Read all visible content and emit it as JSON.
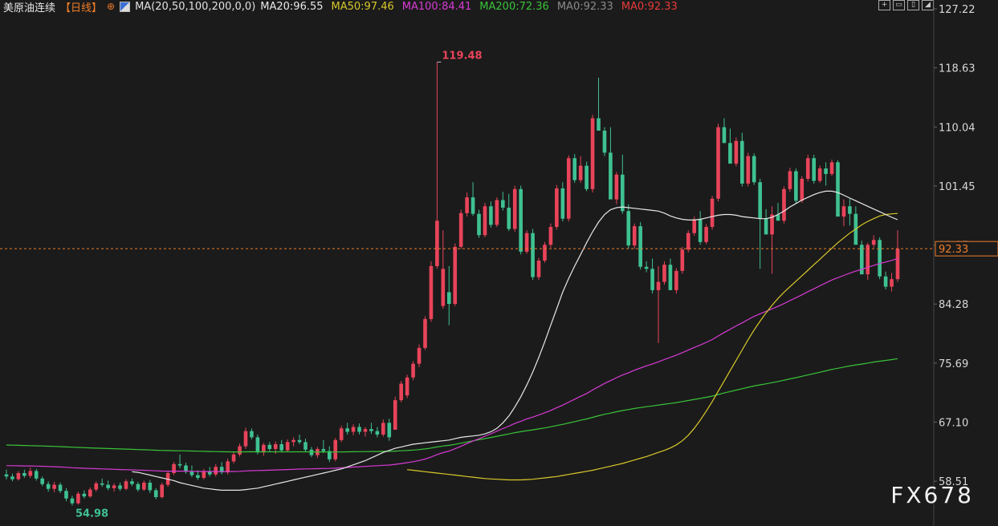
{
  "legend": {
    "title": "美原油连续",
    "period": "【日线】",
    "circle_icon": "⊕",
    "ma_params": "MA(20,50,100,200,0,0)",
    "items": [
      {
        "label": "MA20:96.55",
        "color": "#e8e8e8"
      },
      {
        "label": "MA50:97.46",
        "color": "#d8c82a"
      },
      {
        "label": "MA100:84.41",
        "color": "#d83ad6"
      },
      {
        "label": "MA200:72.36",
        "color": "#39c439"
      },
      {
        "label": "MA0:92.33",
        "color": "#8a8a8a"
      },
      {
        "label": "MA0:92.33",
        "color": "#e83a3a"
      }
    ]
  },
  "watermark": "FX678",
  "colors": {
    "up": "#e8445a",
    "down": "#3fc192",
    "ma20": "#e8e8e8",
    "ma50": "#d8c82a",
    "ma100": "#d83ad6",
    "ma200": "#39c439",
    "current": "#f07d2a"
  },
  "chart_data": {
    "type": "candlestick",
    "ylim": [
      52.0,
      128.5
    ],
    "y_ticks": [
      "127.22",
      "118.63",
      "110.04",
      "101.45",
      "92.87",
      "84.28",
      "75.69",
      "67.10",
      "58.51"
    ],
    "current_price_label": "92.33",
    "annotations": [
      {
        "label": "119.48"
      },
      {
        "label": "54.98"
      }
    ],
    "candles": [
      [
        59.5,
        60.2,
        58.8,
        59.2
      ],
      [
        59.2,
        59.6,
        58.5,
        58.8
      ],
      [
        58.8,
        60.0,
        58.6,
        59.7
      ],
      [
        59.7,
        60.2,
        59.0,
        59.3
      ],
      [
        59.3,
        60.5,
        59.0,
        60.0
      ],
      [
        60.0,
        60.3,
        58.6,
        58.9
      ],
      [
        58.9,
        59.2,
        57.8,
        58.1
      ],
      [
        58.1,
        58.5,
        57.0,
        57.4
      ],
      [
        57.4,
        58.4,
        56.9,
        58.0
      ],
      [
        58.0,
        58.3,
        56.8,
        57.1
      ],
      [
        57.1,
        57.5,
        55.6,
        56.0
      ],
      [
        56.0,
        56.4,
        54.98,
        55.3
      ],
      [
        55.3,
        57.0,
        55.1,
        56.7
      ],
      [
        56.7,
        57.2,
        56.0,
        56.3
      ],
      [
        56.3,
        57.6,
        56.1,
        57.3
      ],
      [
        57.3,
        58.5,
        57.0,
        58.2
      ],
      [
        58.2,
        58.9,
        57.7,
        58.0
      ],
      [
        58.0,
        58.6,
        57.2,
        57.5
      ],
      [
        57.5,
        58.2,
        57.0,
        57.9
      ],
      [
        57.9,
        58.3,
        57.1,
        57.4
      ],
      [
        57.4,
        58.8,
        57.2,
        58.5
      ],
      [
        58.5,
        58.9,
        57.8,
        58.1
      ],
      [
        58.1,
        58.4,
        57.0,
        57.3
      ],
      [
        57.3,
        58.6,
        57.1,
        58.3
      ],
      [
        58.3,
        58.7,
        56.8,
        57.2
      ],
      [
        57.2,
        57.5,
        55.9,
        56.2
      ],
      [
        56.2,
        58.3,
        56.0,
        58.0
      ],
      [
        58.0,
        60.0,
        57.7,
        59.7
      ],
      [
        59.7,
        61.3,
        59.4,
        61.0
      ],
      [
        61.0,
        62.4,
        60.4,
        60.8
      ],
      [
        60.8,
        61.2,
        59.6,
        59.9
      ],
      [
        59.9,
        60.8,
        59.1,
        59.4
      ],
      [
        59.4,
        60.1,
        58.7,
        59.0
      ],
      [
        59.0,
        60.3,
        58.8,
        60.0
      ],
      [
        60.0,
        60.6,
        59.2,
        59.5
      ],
      [
        59.5,
        61.0,
        59.2,
        60.6
      ],
      [
        60.6,
        61.3,
        59.5,
        59.8
      ],
      [
        59.8,
        61.8,
        59.5,
        61.4
      ],
      [
        61.4,
        62.8,
        61.1,
        62.4
      ],
      [
        62.4,
        64.0,
        62.1,
        63.6
      ],
      [
        63.6,
        66.3,
        63.2,
        65.8
      ],
      [
        65.8,
        66.2,
        64.6,
        64.9
      ],
      [
        64.9,
        65.3,
        62.4,
        62.7
      ],
      [
        62.7,
        64.1,
        62.2,
        63.8
      ],
      [
        63.8,
        64.2,
        62.8,
        63.2
      ],
      [
        63.2,
        64.3,
        62.5,
        63.9
      ],
      [
        63.9,
        64.5,
        62.7,
        63.0
      ],
      [
        63.0,
        64.6,
        62.8,
        64.2
      ],
      [
        64.2,
        64.9,
        63.6,
        64.5
      ],
      [
        64.5,
        65.3,
        63.9,
        64.2
      ],
      [
        64.2,
        64.7,
        62.8,
        63.1
      ],
      [
        63.1,
        63.5,
        62.0,
        62.3
      ],
      [
        62.3,
        63.5,
        61.9,
        63.2
      ],
      [
        63.2,
        64.5,
        62.6,
        62.9
      ],
      [
        62.9,
        63.6,
        61.3,
        61.7
      ],
      [
        61.7,
        64.8,
        61.4,
        64.5
      ],
      [
        64.5,
        66.6,
        64.2,
        66.2
      ],
      [
        66.2,
        67.0,
        65.3,
        65.7
      ],
      [
        65.7,
        66.8,
        65.2,
        66.4
      ],
      [
        66.4,
        66.9,
        65.3,
        65.7
      ],
      [
        65.7,
        66.4,
        65.0,
        66.1
      ],
      [
        66.1,
        67.0,
        65.4,
        65.8
      ],
      [
        65.8,
        66.4,
        64.9,
        65.3
      ],
      [
        65.3,
        67.5,
        65.0,
        67.0
      ],
      [
        67.0,
        67.6,
        64.4,
        64.9
      ],
      [
        66.0,
        70.8,
        68.5,
        70.3
      ],
      [
        70.3,
        73.1,
        70.0,
        72.7
      ],
      [
        71.0,
        74.0,
        70.6,
        73.6
      ],
      [
        73.6,
        76.0,
        73.2,
        75.6
      ],
      [
        75.6,
        78.4,
        75.1,
        77.9
      ],
      [
        77.9,
        82.5,
        77.6,
        82.1
      ],
      [
        82.1,
        90.5,
        81.7,
        89.8
      ],
      [
        89.8,
        119.48,
        89.4,
        96.4
      ],
      [
        84.0,
        95.0,
        83.6,
        89.4
      ],
      [
        86.0,
        89.8,
        81.2,
        84.3
      ],
      [
        84.3,
        93.1,
        84.0,
        92.6
      ],
      [
        92.6,
        98.0,
        92.3,
        97.5
      ],
      [
        97.5,
        100.5,
        97.0,
        99.8
      ],
      [
        99.8,
        102.0,
        97.1,
        97.4
      ],
      [
        97.4,
        98.0,
        93.9,
        94.3
      ],
      [
        94.3,
        99.0,
        94.0,
        98.5
      ],
      [
        98.5,
        99.2,
        95.4,
        95.8
      ],
      [
        95.8,
        99.8,
        95.5,
        99.4
      ],
      [
        99.4,
        100.6,
        97.9,
        98.3
      ],
      [
        98.3,
        100.3,
        94.9,
        95.2
      ],
      [
        95.2,
        101.5,
        94.8,
        101.0
      ],
      [
        101.0,
        101.5,
        91.5,
        91.9
      ],
      [
        91.9,
        95.0,
        91.6,
        94.6
      ],
      [
        94.6,
        95.2,
        87.8,
        88.2
      ],
      [
        88.2,
        91.0,
        87.8,
        90.6
      ],
      [
        90.6,
        93.3,
        90.3,
        92.9
      ],
      [
        92.9,
        96.0,
        92.5,
        95.5
      ],
      [
        95.5,
        101.6,
        95.1,
        101.1
      ],
      [
        101.1,
        102.0,
        96.3,
        96.7
      ],
      [
        96.7,
        105.9,
        96.3,
        105.5
      ],
      [
        105.5,
        106.1,
        101.9,
        102.3
      ],
      [
        102.3,
        105.8,
        101.9,
        104.4
      ],
      [
        104.4,
        105.0,
        100.7,
        101.0
      ],
      [
        101.0,
        111.8,
        100.5,
        111.3
      ],
      [
        111.3,
        117.2,
        109.7,
        109.5
      ],
      [
        109.5,
        110.0,
        105.8,
        106.3
      ],
      [
        106.3,
        110.0,
        101.5,
        99.5
      ],
      [
        99.5,
        103.5,
        98.8,
        103.1
      ],
      [
        103.1,
        106.0,
        97.4,
        97.8
      ],
      [
        97.8,
        98.8,
        92.3,
        92.8
      ],
      [
        92.8,
        96.0,
        92.3,
        95.6
      ],
      [
        95.6,
        96.2,
        89.3,
        89.7
      ],
      [
        89.7,
        90.5,
        88.9,
        89.4
      ],
      [
        89.4,
        90.9,
        85.8,
        86.3
      ],
      [
        86.3,
        89.8,
        78.6,
        87.5
      ],
      [
        87.5,
        90.5,
        87.1,
        90.0
      ],
      [
        90.0,
        90.9,
        88.3,
        86.3
      ],
      [
        86.3,
        89.5,
        85.8,
        89.1
      ],
      [
        89.1,
        92.6,
        88.7,
        92.2
      ],
      [
        92.2,
        95.0,
        91.8,
        94.6
      ],
      [
        94.6,
        97.0,
        94.2,
        96.6
      ],
      [
        96.6,
        97.8,
        92.9,
        93.3
      ],
      [
        93.3,
        95.9,
        93.0,
        95.5
      ],
      [
        95.5,
        100.0,
        95.1,
        99.6
      ],
      [
        99.6,
        110.5,
        99.2,
        110.0
      ],
      [
        110.0,
        111.3,
        107.7,
        107.7
      ],
      [
        107.7,
        109.8,
        104.7,
        104.7
      ],
      [
        104.7,
        108.5,
        104.3,
        108.0
      ],
      [
        108.0,
        109.2,
        101.4,
        101.8
      ],
      [
        101.8,
        106.3,
        101.4,
        105.8
      ],
      [
        105.8,
        106.2,
        101.6,
        102.0
      ],
      [
        102.0,
        102.5,
        89.4,
        96.7
      ],
      [
        96.7,
        98.1,
        94.4,
        94.4
      ],
      [
        94.4,
        98.5,
        88.7,
        97.3
      ],
      [
        97.3,
        99.0,
        96.8,
        96.4
      ],
      [
        96.4,
        101.4,
        96.0,
        101.0
      ],
      [
        101.0,
        104.1,
        100.6,
        103.6
      ],
      [
        103.6,
        104.0,
        98.9,
        99.3
      ],
      [
        99.3,
        102.9,
        99.0,
        102.5
      ],
      [
        102.5,
        106.0,
        102.1,
        105.5
      ],
      [
        105.5,
        106.0,
        101.8,
        102.2
      ],
      [
        102.2,
        104.4,
        101.9,
        104.0
      ],
      [
        104.0,
        104.9,
        101.5,
        103.2
      ],
      [
        103.2,
        105.3,
        102.9,
        104.9
      ],
      [
        104.9,
        105.2,
        101.4,
        97.0
      ],
      [
        97.0,
        99.5,
        95.6,
        98.5
      ],
      [
        98.5,
        99.6,
        95.7,
        97.4
      ],
      [
        97.4,
        98.5,
        93.2,
        92.9
      ],
      [
        92.9,
        93.5,
        88.8,
        88.6
      ],
      [
        88.6,
        93.2,
        87.8,
        92.9
      ],
      [
        92.9,
        94.3,
        92.5,
        93.6
      ],
      [
        93.6,
        94.0,
        87.9,
        88.3
      ],
      [
        88.3,
        89.0,
        86.4,
        86.8
      ],
      [
        86.8,
        88.8,
        86.1,
        87.9
      ],
      [
        87.9,
        95.0,
        87.5,
        92.33
      ]
    ],
    "ma20": [
      59.9,
      59.8,
      59.6,
      59.4,
      59.2,
      59.0,
      58.8,
      58.6,
      58.3,
      58.1,
      57.9,
      57.7,
      57.5,
      57.4,
      57.3,
      57.2,
      57.2,
      57.2,
      57.2,
      57.3,
      57.4,
      57.5,
      57.7,
      57.9,
      58.1,
      58.3,
      58.5,
      58.7,
      58.9,
      59.1,
      59.3,
      59.5,
      59.7,
      59.9,
      60.1,
      60.3,
      60.6,
      60.9,
      61.2,
      61.5,
      61.9,
      62.3,
      62.7,
      63.0,
      63.3,
      63.5,
      63.7,
      63.9,
      64.0,
      64.1,
      64.2,
      64.3,
      64.4,
      64.5,
      64.7,
      64.9,
      65.0,
      65.1,
      65.2,
      65.4,
      65.7,
      66.2,
      67.0,
      68.0,
      69.3,
      70.8,
      72.5,
      74.4,
      76.5,
      78.8,
      81.2,
      83.6,
      86.0,
      88.0,
      89.8,
      91.5,
      93.2,
      94.8,
      96.2,
      97.3,
      98.0,
      98.3,
      98.4,
      98.3,
      98.2,
      98.1,
      98.0,
      97.9,
      97.8,
      97.5,
      97.1,
      96.8,
      96.6,
      96.5,
      96.5,
      96.6,
      96.8,
      97.0,
      97.2,
      97.3,
      97.3,
      97.2,
      97.0,
      96.9,
      96.8,
      96.7,
      96.7,
      96.9,
      97.3,
      97.8,
      98.4,
      98.9,
      99.4,
      99.8,
      100.2,
      100.5,
      100.7,
      100.7,
      100.5,
      100.1,
      99.7,
      99.3,
      98.9,
      98.5,
      98.1,
      97.7,
      97.3,
      96.9,
      96.55
    ],
    "ma50": [
      60.2,
      60.1,
      60.0,
      59.9,
      59.8,
      59.7,
      59.6,
      59.5,
      59.4,
      59.3,
      59.2,
      59.1,
      59.0,
      58.9,
      58.85,
      58.8,
      58.75,
      58.7,
      58.7,
      58.7,
      58.75,
      58.8,
      58.9,
      59.0,
      59.1,
      59.2,
      59.35,
      59.5,
      59.65,
      59.8,
      59.95,
      60.1,
      60.3,
      60.5,
      60.7,
      60.9,
      61.1,
      61.35,
      61.6,
      61.85,
      62.1,
      62.4,
      62.7,
      63.0,
      63.35,
      63.8,
      64.4,
      65.2,
      66.2,
      67.4,
      68.7,
      70.1,
      71.6,
      73.1,
      74.6,
      76.1,
      77.6,
      79.1,
      80.5,
      81.8,
      83.0,
      84.1,
      85.1,
      86.0,
      86.8,
      87.6,
      88.4,
      89.2,
      90.0,
      90.8,
      91.6,
      92.4,
      93.2,
      93.9,
      94.6,
      95.2,
      95.8,
      96.3,
      96.7,
      97.1,
      97.3,
      97.4,
      97.46
    ]
  }
}
